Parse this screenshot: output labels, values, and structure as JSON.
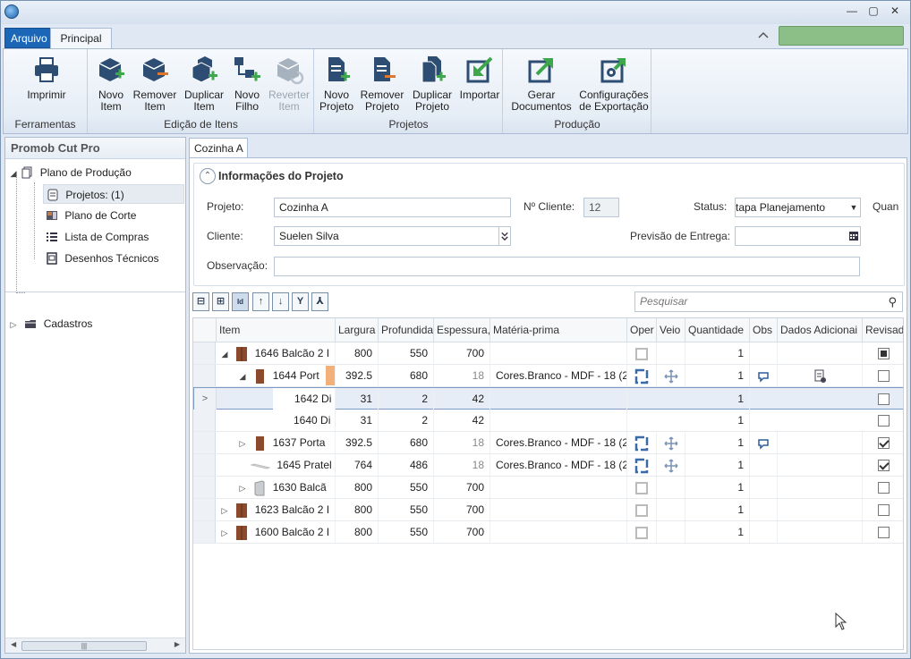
{
  "window": {
    "min_glyph": "—",
    "max_glyph": "▢",
    "close_glyph": "✕"
  },
  "ribbon_tabs": {
    "file": "Arquivo",
    "main": "Principal"
  },
  "ribbon": {
    "groups": {
      "ferramentas": "Ferramentas",
      "edicao": "Edição de Itens",
      "projetos": "Projetos",
      "producao": "Produção"
    },
    "buttons": {
      "imprimir": "Imprimir",
      "novo_item_1": "Novo",
      "novo_item_2": "Item",
      "remover_item_1": "Remover",
      "remover_item_2": "Item",
      "duplicar_item_1": "Duplicar",
      "duplicar_item_2": "Item",
      "novo_filho_1": "Novo",
      "novo_filho_2": "Filho",
      "reverter_item_1": "Reverter",
      "reverter_item_2": "Item",
      "novo_projeto_1": "Novo",
      "novo_projeto_2": "Projeto",
      "remover_projeto_1": "Remover",
      "remover_projeto_2": "Projeto",
      "duplicar_projeto_1": "Duplicar",
      "duplicar_projeto_2": "Projeto",
      "importar": "Importar",
      "gerar_doc_1": "Gerar",
      "gerar_doc_2": "Documentos",
      "config_exp_1": "Configurações",
      "config_exp_2": "de Exportação"
    }
  },
  "left_panel": {
    "title": "Promob Cut Pro",
    "tree": {
      "plano_producao": "Plano de Produção",
      "projetos": "Projetos: (1)",
      "plano_corte": "Plano de Corte",
      "lista_compras": "Lista de Compras",
      "desenhos": "Desenhos Técnicos",
      "cadastros": "Cadastros"
    }
  },
  "doc_tab": "Cozinha A",
  "project_info": {
    "title": "Informações do Projeto",
    "projeto_label": "Projeto:",
    "projeto_value": "Cozinha A",
    "ncliente_label": "Nº Cliente:",
    "ncliente_value": "12",
    "status_label": "Status:",
    "status_value": "tapa Planejamento",
    "quant_label": "Quan",
    "cliente_label": "Cliente:",
    "cliente_value": "Suelen Silva",
    "previsao_label": "Previsão de Entrega:",
    "previsao_value": "",
    "observacao_label": "Observação:",
    "observacao_value": ""
  },
  "search": {
    "placeholder": "Pesquisar"
  },
  "grid": {
    "headers": {
      "item": "Item",
      "largura": "Largura",
      "profundidade": "Profundida",
      "espessura": "Espessura,",
      "materia": "Matéria-prima",
      "oper": "Oper",
      "veio": "Veio",
      "quantidade": "Quantidade",
      "obs": "Obs",
      "dados": "Dados Adicionai",
      "revisado": "Revisad"
    },
    "rows": [
      {
        "item": "1646  Balcão 2 I",
        "largura": "800",
        "profundidade": "550",
        "espessura": "700",
        "materia": "",
        "quantidade": "1"
      },
      {
        "item": "1644  Port",
        "largura": "392.5",
        "profundidade": "680",
        "espessura": "18",
        "materia": "Cores.Branco - MDF - 18 (2",
        "quantidade": "1"
      },
      {
        "item": "1642  Di",
        "largura": "31",
        "profundidade": "2",
        "espessura": "42",
        "materia": "",
        "quantidade": "1"
      },
      {
        "item": "1640  Di",
        "largura": "31",
        "profundidade": "2",
        "espessura": "42",
        "materia": "",
        "quantidade": "1"
      },
      {
        "item": "1637  Porta",
        "largura": "392.5",
        "profundidade": "680",
        "espessura": "18",
        "materia": "Cores.Branco - MDF - 18 (2",
        "quantidade": "1"
      },
      {
        "item": "1645  Pratel",
        "largura": "764",
        "profundidade": "486",
        "espessura": "18",
        "materia": "Cores.Branco - MDF - 18 (2",
        "quantidade": "1"
      },
      {
        "item": "1630  Balcã",
        "largura": "800",
        "profundidade": "550",
        "espessura": "700",
        "materia": "",
        "quantidade": "1"
      },
      {
        "item": "1623  Balcão 2 I",
        "largura": "800",
        "profundidade": "550",
        "espessura": "700",
        "materia": "",
        "quantidade": "1"
      },
      {
        "item": "1600  Balcão 2 I",
        "largura": "800",
        "profundidade": "550",
        "espessura": "700",
        "materia": "",
        "quantidade": "1"
      }
    ],
    "current_row_marker": ">"
  },
  "colors": {
    "accent": "#1b66b6",
    "status_green": "#8cbf88"
  }
}
